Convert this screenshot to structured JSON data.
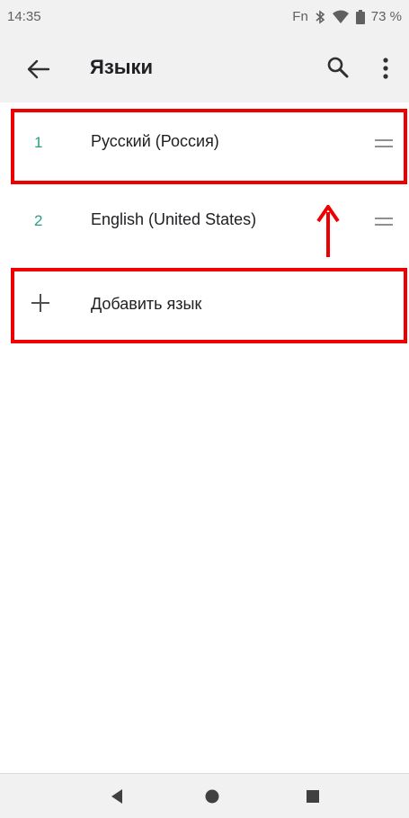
{
  "status_bar": {
    "time": "14:35",
    "fn": "Fn",
    "battery": "73 %",
    "icons": [
      "bluetooth-icon",
      "wifi-icon",
      "battery-icon"
    ]
  },
  "app_bar": {
    "title": "Языки",
    "icons": [
      "back-arrow-icon",
      "search-icon",
      "more-vert-icon"
    ]
  },
  "languages": [
    {
      "number": "1",
      "name": "Русский (Россия)"
    },
    {
      "number": "2",
      "name": "English (United States)"
    }
  ],
  "add_language": {
    "label": "Добавить язык",
    "icon": "plus-icon"
  },
  "nav_bar": {
    "icons": [
      "back-triangle-icon",
      "home-circle-icon",
      "recents-square-icon"
    ]
  },
  "colors": {
    "accent": "#2a9d85",
    "highlight": "#ee0000",
    "bar_background": "#f1f1f1"
  }
}
